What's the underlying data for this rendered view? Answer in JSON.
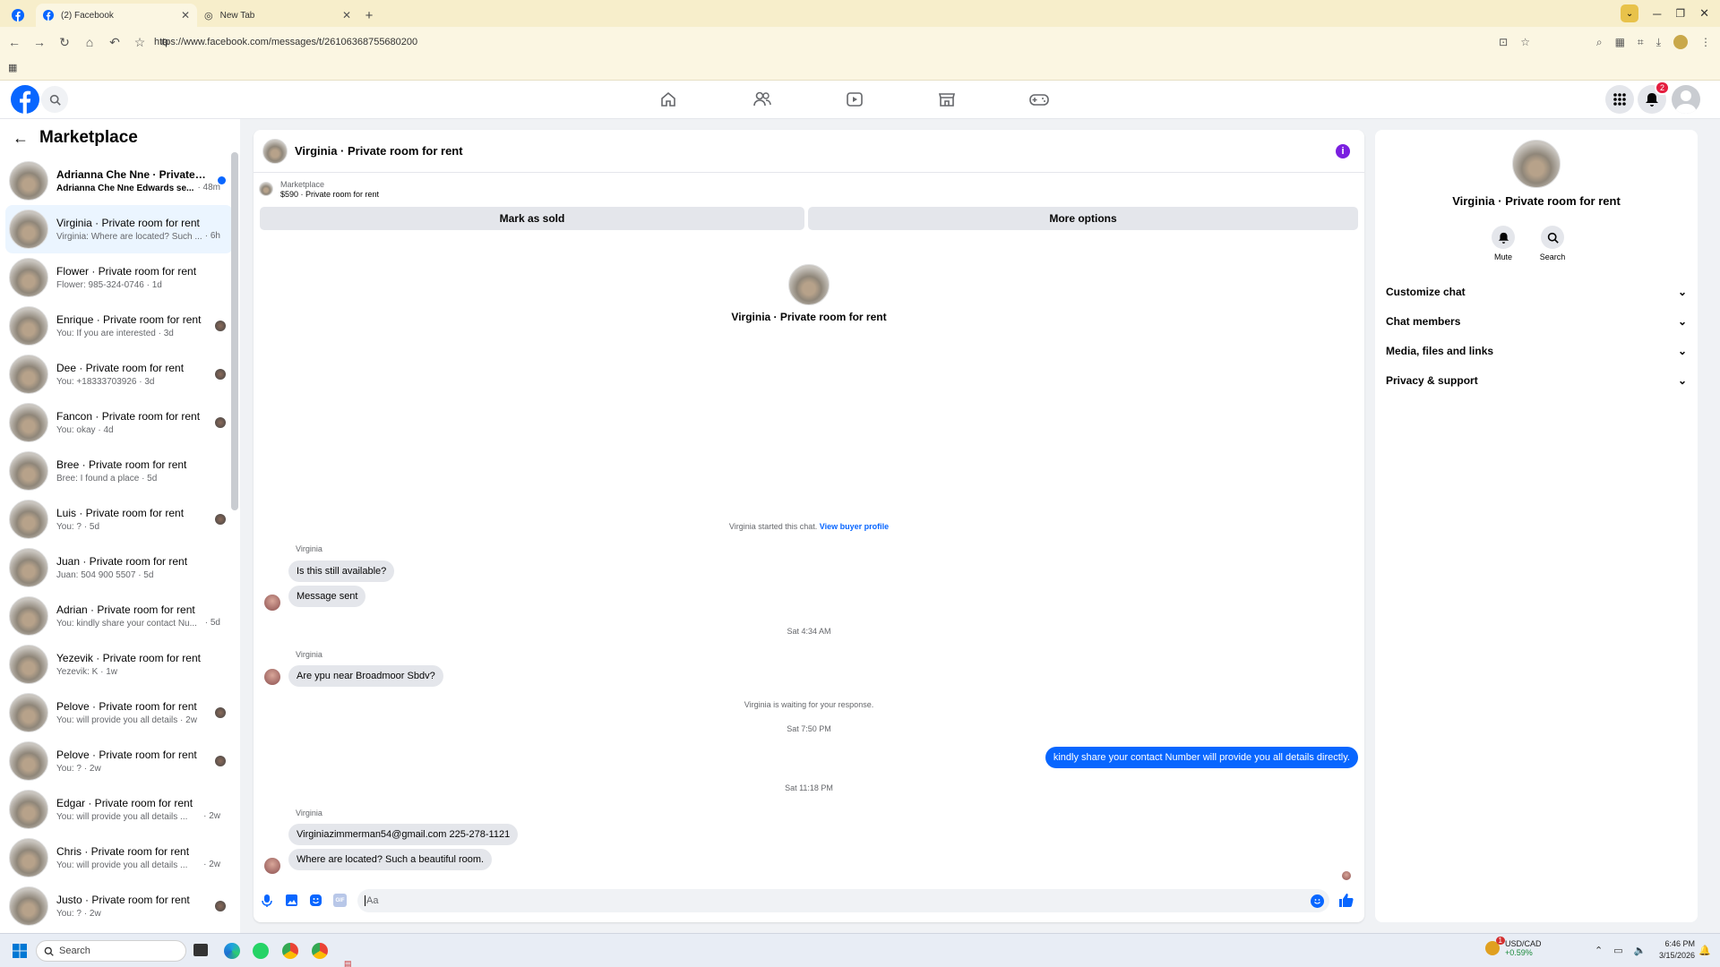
{
  "browser": {
    "tabs": [
      {
        "label": "(2) Facebook",
        "active": true
      },
      {
        "label": "New Tab",
        "active": false
      }
    ],
    "url": "https://www.facebook.com/messages/t/26106368755680200"
  },
  "header": {
    "notification_count": "2",
    "brand_color": "#0866ff"
  },
  "sidebar": {
    "title": "Marketplace",
    "conversations": [
      {
        "name": "Adrianna Che Nne · Private ro...",
        "preview": "Adrianna Che Nne Edwards se...",
        "time": "· 48m",
        "unread": true
      },
      {
        "name": "Virginia · Private room for rent",
        "preview": "Virginia: Where are located? Such ...",
        "time": "· 6h",
        "selected": true
      },
      {
        "name": "Flower · Private room for rent",
        "preview": "Flower: 985-324-0746 · 1d"
      },
      {
        "name": "Enrique · Private room for rent",
        "preview": "You: If you are interested · 3d"
      },
      {
        "name": "Dee · Private room for rent",
        "preview": "You: +18333703926 · 3d"
      },
      {
        "name": "Fancon · Private room for rent",
        "preview": "You: okay · 4d"
      },
      {
        "name": "Bree · Private room for rent",
        "preview": "Bree: I found a place · 5d"
      },
      {
        "name": "Luis · Private room for rent",
        "preview": "You: ? · 5d"
      },
      {
        "name": "Juan · Private room for rent",
        "preview": "Juan: 504 900 5507 · 5d"
      },
      {
        "name": "Adrian · Private room for rent",
        "preview": "You: kindly share your contact Nu...",
        "time": "· 5d"
      },
      {
        "name": "Yezevik · Private room for rent",
        "preview": "Yezevik: K · 1w"
      },
      {
        "name": "Pelove · Private room for rent",
        "preview": "You: will provide you all details · 2w"
      },
      {
        "name": "Pelove · Private room for rent",
        "preview": "You: ? · 2w"
      },
      {
        "name": "Edgar · Private room for rent",
        "preview": "You: will provide you all details ...",
        "time": "· 2w"
      },
      {
        "name": "Chris · Private room for rent",
        "preview": "You: will provide you all details ...",
        "time": "· 2w"
      },
      {
        "name": "Justo · Private room for rent",
        "preview": "You: ? · 2w"
      }
    ]
  },
  "chat": {
    "title": "Virginia · Private room for rent",
    "marketplace_label": "Marketplace",
    "listing": "$590 · Private room for rent",
    "mark_sold": "Mark as sold",
    "more_options": "More options",
    "intro_name": "Virginia · Private room for rent",
    "started_text": "Virginia started this chat.",
    "buyer_profile_link": "View buyer profile",
    "sender_name": "Virginia",
    "msg1": "Is this still available?",
    "msg2": "Message sent",
    "stamp1": "Sat 4:34 AM",
    "msg3": "Are ypu near Broadmoor Sbdv?",
    "waiting": "Virginia is waiting for your response.",
    "stamp2": "Sat 7:50 PM",
    "my_msg": "kindly share your contact Number will provide you all details directly.",
    "stamp3": "Sat 11:18 PM",
    "msg4": "Virginiazimmerman54@gmail.com 225-278-1121",
    "msg5": "Where are located? Such a beautiful room.",
    "composer_placeholder": "Aa"
  },
  "details": {
    "title": "Virginia · Private room for rent",
    "mute": "Mute",
    "search": "Search",
    "sections": [
      "Customize chat",
      "Chat members",
      "Media, files and links",
      "Privacy & support"
    ]
  },
  "taskbar": {
    "search_placeholder": "Search",
    "ticker": "USD/CAD",
    "ticker_change": "+0.59%",
    "ticker_badge": "1",
    "time": "6:46 PM",
    "date": "3/15/2026"
  }
}
